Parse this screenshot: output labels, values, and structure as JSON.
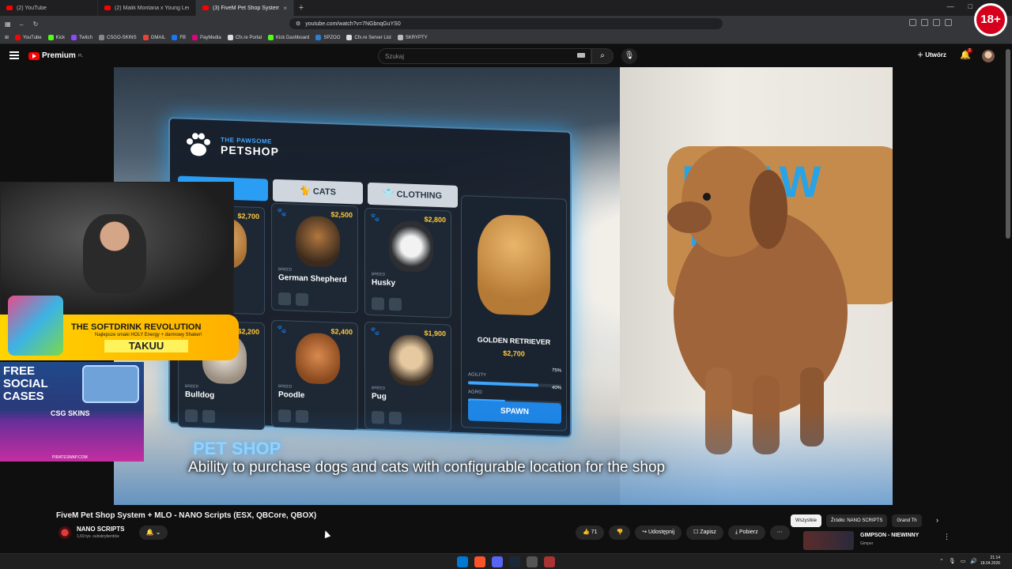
{
  "browser": {
    "tabs": [
      {
        "label": "(2) YouTube",
        "active": false
      },
      {
        "label": "(2) Malik Montana x Young Leosia - ",
        "active": false
      },
      {
        "label": "(3) FiveM Pet Shop System – ",
        "active": true
      }
    ],
    "url": "youtube.com/watch?v=7NGbnqGuYS0",
    "bookmarks": [
      "YouTube",
      "Kick",
      "Twitch",
      "CSGO-SKINS",
      "GMAIL",
      "FB",
      "PayMedia",
      "Cfx.re Portal",
      "Kick Dashboard",
      "SPZOO",
      "Cfx.re Server List",
      "SKRYPTY"
    ]
  },
  "youtube": {
    "logo": "Premium",
    "logo_sup": "PL",
    "search_placeholder": "Szukaj",
    "create_label": "Utwórz",
    "notifications": "2",
    "age_badge": "18+"
  },
  "video": {
    "panel": {
      "brand_small": "THE PAWSOME",
      "brand_big": "PETSHOP",
      "tabs": [
        "GS",
        "CATS",
        "CLOTHING"
      ],
      "cards": [
        {
          "price": "$2,700",
          "breed_label": "",
          "name": "riever"
        },
        {
          "price": "$2,500",
          "breed_label": "BREED",
          "name": "German Shepherd"
        },
        {
          "price": "$2,800",
          "breed_label": "BREED",
          "name": "Husky"
        },
        {
          "price": "$2,200",
          "breed_label": "BREED",
          "name": "Bulldog"
        },
        {
          "price": "$2,400",
          "breed_label": "BREED",
          "name": "Poodle"
        },
        {
          "price": "$1,900",
          "breed_label": "BREED",
          "name": "Pug"
        }
      ],
      "detail": {
        "name": "GOLDEN RETRIEVER",
        "price": "$2,700",
        "stats": [
          {
            "label": "AGILITY",
            "value": "75%",
            "level": 0.75
          },
          {
            "label": "AGRO",
            "value": "40%",
            "level": 0.4
          }
        ],
        "spawn_label": "SPAWN"
      }
    },
    "sign_text": "E PAW\nTSH",
    "pet_shop_title": "PET SHOP",
    "subtitle": "Ability to purchase dogs and cats with configurable location for the shop"
  },
  "overlay": {
    "promo_title": "THE SOFTDRINK REVOLUTION",
    "promo_sub": "Najlepsze smaki HOLY Energy + darmowy Shaker!",
    "promo_code": "TAKUU",
    "cases_title": "FREE\nSOCIAL\nCASES",
    "cases_brand": "CSG SKINS",
    "cases_site": "PIRATESWAP.COM"
  },
  "below": {
    "title": "FiveM Pet Shop System + MLO - NANO Scripts (ESX, QBCore, QBOX)",
    "channel": "NANO SCRIPTS",
    "subs": "1,69 tys. subskrybentów",
    "likes": "71",
    "share": "Udostępnij",
    "save": "Zapisz",
    "download": "Pobierz",
    "chips": [
      "Wszystkie",
      "Źródło: NANO SCRIPTS",
      "Grand Th"
    ],
    "related_title": "GIMPSON - NIEWINNY",
    "related_channel": "Gimper"
  },
  "taskbar": {
    "time": "21:14",
    "date": "18.04.2026"
  },
  "colors": {
    "accent_blue": "#2a9df4",
    "price_gold": "#ffc73c",
    "youtube_red": "#ff0000"
  }
}
